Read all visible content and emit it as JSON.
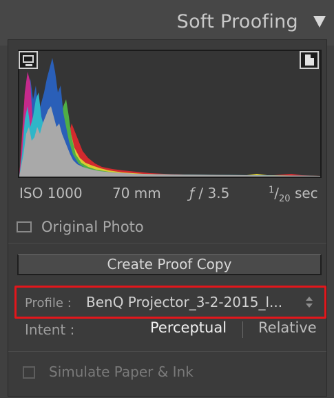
{
  "panel": {
    "title": "Soft Proofing"
  },
  "histogram": {
    "colors": {
      "red": "#d32a2e",
      "yellow": "#d9cc32",
      "green": "#4fae46",
      "blue": "#2a5fb8",
      "cyan": "#2fb6c8",
      "magenta": "#c42a8c",
      "gray": "#a9a9a9"
    }
  },
  "exif": {
    "iso": "ISO 1000",
    "focal_length": "70 mm",
    "aperture_symbol": "ƒ",
    "aperture_value": "/ 3.5",
    "shutter_num": "1",
    "shutter_den": "20",
    "shutter_unit": "sec"
  },
  "original_photo": {
    "label": "Original Photo"
  },
  "create_proof_copy": {
    "label": "Create Proof Copy"
  },
  "profile": {
    "label": "Profile :",
    "value": "BenQ Projector_3-2-2015_l..."
  },
  "intent": {
    "label": "Intent :",
    "options": [
      "Perceptual",
      "Relative"
    ],
    "selected": "Perceptual"
  },
  "simulate": {
    "label": "Simulate Paper & Ink"
  }
}
